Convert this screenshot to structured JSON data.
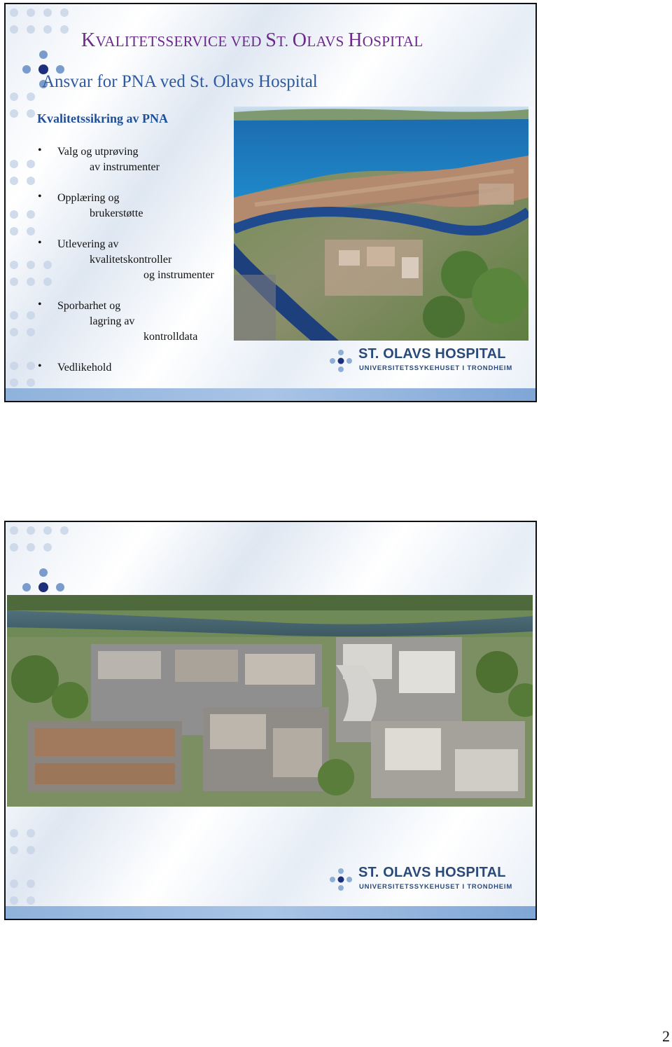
{
  "slide1": {
    "title_parts": [
      "K",
      "VALITETSSERVICE VED ",
      "S",
      "T. ",
      "O",
      "LAVS ",
      "H",
      "OSPITAL"
    ],
    "subtitle_a": "Ansvar for PNA ved St",
    "subtitle_b": ". Olavs Hospital",
    "section_heading": "Kvalitetssikring av PNA",
    "bullets": [
      {
        "line1": "Valg og utprøving",
        "line2": "av instrumenter"
      },
      {
        "line1": "Opplæring og",
        "line2": "brukerstøtte"
      },
      {
        "line1": "Utlevering av",
        "line2": "kvalitetskontroller",
        "line3": "og instrumenter"
      },
      {
        "line1": "Sporbarhet og",
        "line2": "lagring av",
        "line3": "kontrolldata"
      },
      {
        "line1": "Vedlikehold"
      }
    ],
    "photo_icon": "aerial-city-photo"
  },
  "slide2": {
    "photo_icon": "aerial-hospital-campus-photo"
  },
  "logo": {
    "name": "ST. OLAVS HOSPITAL",
    "subtitle": "UNIVERSITETSSYKEHUSET I TRONDHEIM"
  },
  "colors": {
    "title": "#6b2a8c",
    "subtitle": "#2d5aa0",
    "logo": "#2a4a7a",
    "footer_bar": "#8fb2dc"
  },
  "bullet_glyph": "•",
  "page_number": "2"
}
